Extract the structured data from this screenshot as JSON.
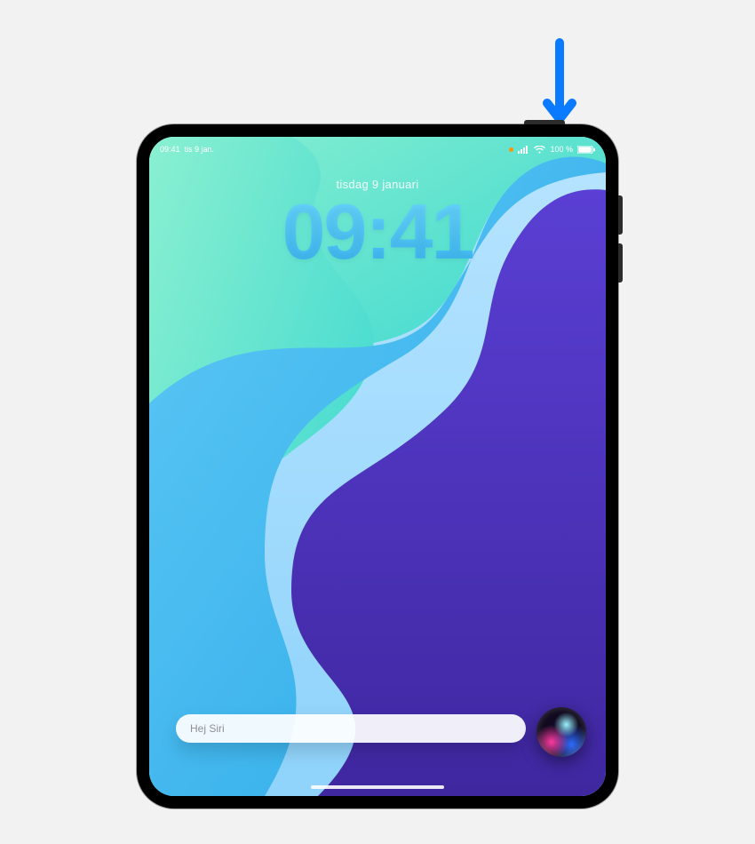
{
  "status": {
    "time": "09:41",
    "date_short": "tis 9 jan.",
    "battery": "100 %"
  },
  "lock": {
    "date": "tisdag 9 januari",
    "time": "09:41"
  },
  "siri": {
    "placeholder": "Hej Siri"
  },
  "colors": {
    "arrow": "#0a7bff",
    "wallpaper_teal": "#30d7cf",
    "wallpaper_cyan": "#3db9ef",
    "wallpaper_indigo": "#4a2fb0"
  }
}
